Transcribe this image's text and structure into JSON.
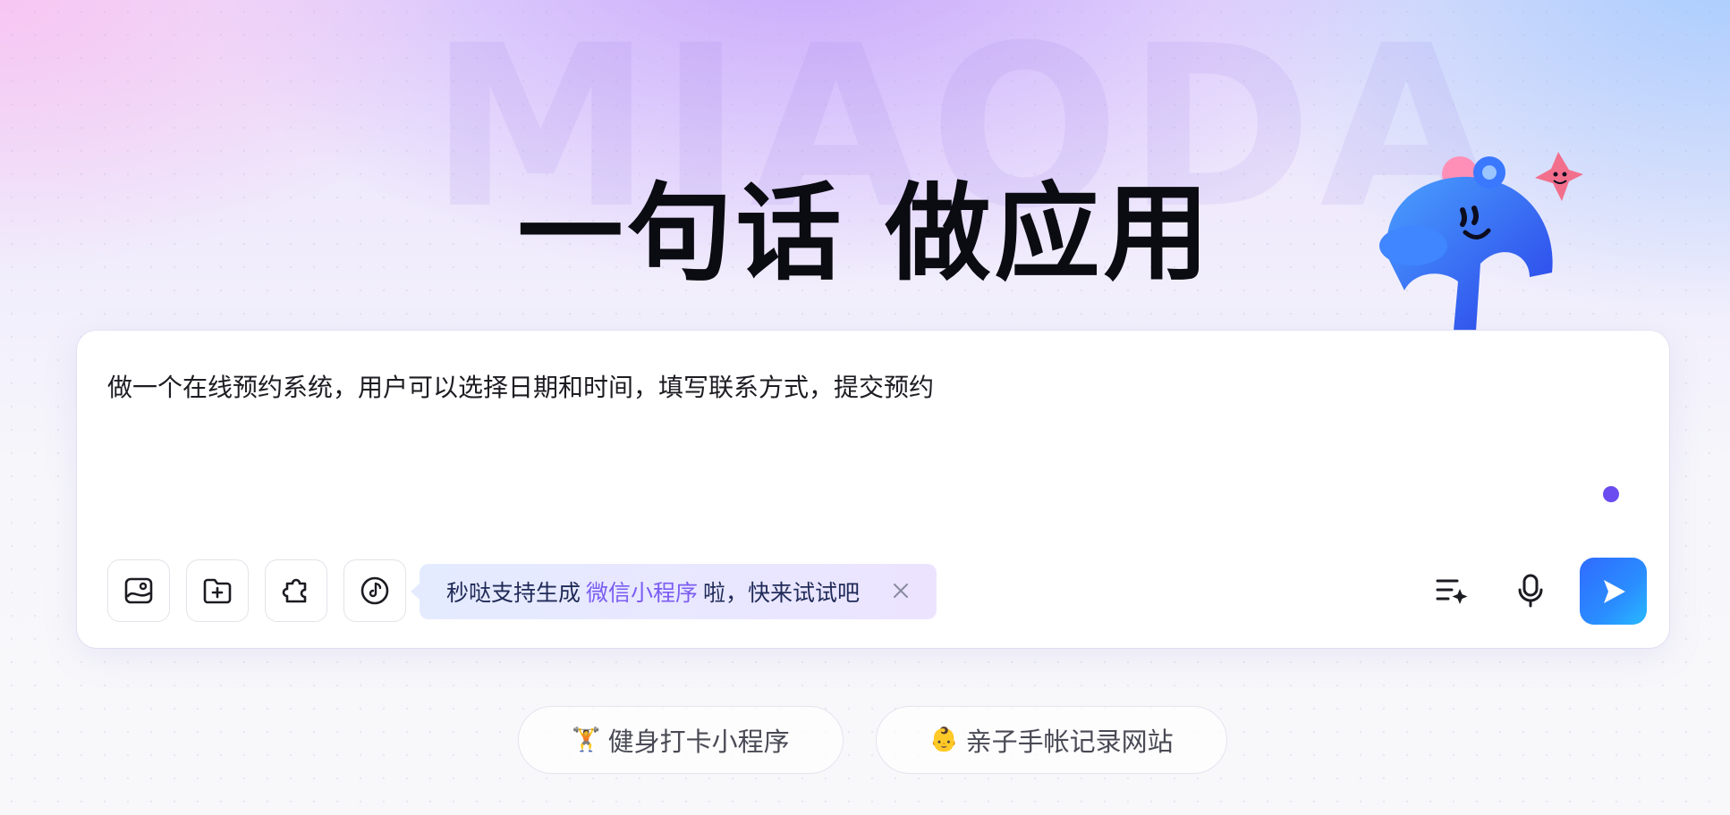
{
  "brand": {
    "watermark": "MIAODA"
  },
  "hero": {
    "headline": "一句话 做应用"
  },
  "composer": {
    "prompt_text": "做一个在线预约系统，用户可以选择日期和时间，填写联系方式，提交预约",
    "tools": [
      {
        "name": "image-upload-icon"
      },
      {
        "name": "folder-add-icon"
      },
      {
        "name": "plugin-puzzle-icon"
      },
      {
        "name": "music-note-icon"
      }
    ],
    "tip": {
      "prefix": "秒哒支持生成",
      "highlight": "微信小程序",
      "suffix": "啦，快来试试吧"
    },
    "right_icons": [
      {
        "name": "prompt-enhance-icon"
      },
      {
        "name": "microphone-icon"
      }
    ],
    "send_icon": "send-arrow-icon",
    "accent_color": "#2f6bff",
    "highlight_color": "#7b5cf2"
  },
  "suggestions": [
    {
      "emoji": "🏋️",
      "label": "健身打卡小程序"
    },
    {
      "emoji": "👶",
      "label": "亲子手帐记录网站"
    }
  ]
}
